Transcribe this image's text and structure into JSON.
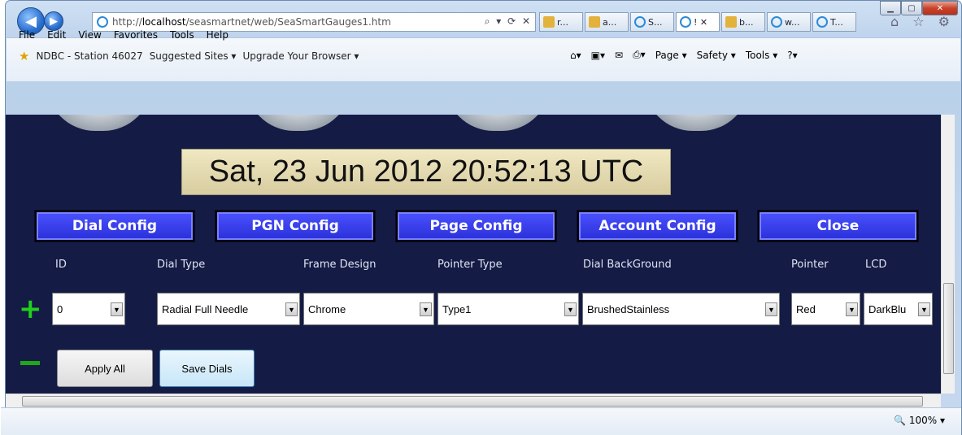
{
  "browser": {
    "url_prefix": "http://",
    "url_host": "localhost",
    "url_path": "/seasmartnet/web/SeaSmartGauges1.htm",
    "url_tools": "⌕ ▾ ⟳ ✕",
    "tabs": [
      {
        "label": "r...",
        "icon": "bing-icon"
      },
      {
        "label": "a...",
        "icon": "bing-icon"
      },
      {
        "label": "S...",
        "icon": "ie-icon"
      },
      {
        "label": "! ✕",
        "icon": "ie-icon"
      },
      {
        "label": "b...",
        "icon": "bing-icon"
      },
      {
        "label": "w...",
        "icon": "ie-icon"
      },
      {
        "label": "T...",
        "icon": "ie-icon"
      }
    ],
    "right_icons": "⌂ ☆ ⚙",
    "menus": [
      "File",
      "Edit",
      "View",
      "Favorites",
      "Tools",
      "Help"
    ],
    "favorites": [
      "NDBC - Station 46027",
      "Suggested Sites ▾",
      "Upgrade Your Browser ▾"
    ],
    "commands": [
      "Page ▾",
      "Safety ▾",
      "Tools ▾",
      "?▾"
    ],
    "zoom": "100%"
  },
  "page": {
    "datetime": "Sat, 23 Jun 2012 20:52:13 UTC",
    "config_buttons": [
      "Dial Config",
      "PGN Config",
      "Page Config",
      "Account Config",
      "Close"
    ],
    "columns": {
      "id": "ID",
      "dial_type": "Dial Type",
      "frame_design": "Frame Design",
      "pointer_type": "Pointer Type",
      "dial_background": "Dial BackGround",
      "pointer": "Pointer",
      "lcd": "LCD"
    },
    "values": {
      "id": "0",
      "dial_type": "Radial Full Needle",
      "frame_design": "Chrome",
      "pointer_type": "Type1",
      "dial_background": "BrushedStainless",
      "pointer": "Red",
      "lcd": "DarkBlu"
    },
    "apply_all": "Apply All",
    "save_dials": "Save Dials"
  },
  "colors": {
    "page_bg": "#141c45",
    "config_button": "#3a40f0",
    "add_green": "#1fd11a"
  }
}
